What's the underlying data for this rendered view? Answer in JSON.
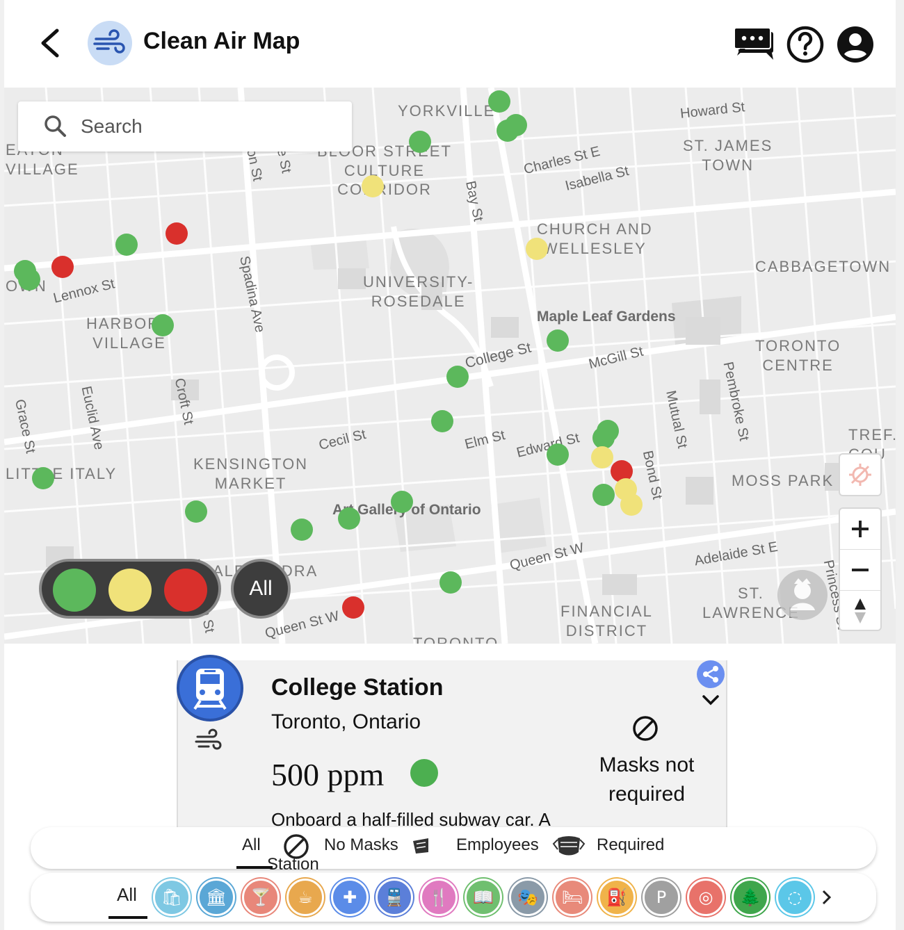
{
  "header": {
    "title": "Clean Air Map"
  },
  "search": {
    "placeholder": "Search"
  },
  "map": {
    "neighbourhoods": [
      {
        "id": "yorkville",
        "label": "YORKVILLE"
      },
      {
        "id": "eaton-village",
        "label": "EATON\nVILLAGE"
      },
      {
        "id": "bloor-st-culture-corridor",
        "label": "BLOOR STREET\nCULTURE\nCORRIDOR"
      },
      {
        "id": "st-james-town",
        "label": "ST. JAMES\nTOWN"
      },
      {
        "id": "church-and-wellesley",
        "label": "CHURCH AND\nWELLESLEY"
      },
      {
        "id": "cabbagetown",
        "label": "CABBAGETOWN"
      },
      {
        "id": "university-rosedale",
        "label": "UNIVERSITY-\nROSEDALE"
      },
      {
        "id": "harbord-village",
        "label": "HARBORD\nVILLAGE"
      },
      {
        "id": "toronto-centre",
        "label": "TORONTO\nCENTRE"
      },
      {
        "id": "kensington-market",
        "label": "KENSINGTON\nMARKET"
      },
      {
        "id": "little-italy",
        "label": "LITTLE ITALY"
      },
      {
        "id": "moss-park",
        "label": "MOSS PARK"
      },
      {
        "id": "alexandra-park",
        "label": "ALEXANDRA\nPARK"
      },
      {
        "id": "financial-district",
        "label": "FINANCIAL\nDISTRICT"
      },
      {
        "id": "st-lawrence",
        "label": "ST.\nLAWRENCE"
      },
      {
        "id": "trefann-court",
        "label": "TREF.\nCOU"
      },
      {
        "id": "toronto-bottom",
        "label": "TORONTO"
      },
      {
        "id": "own",
        "label": "OWN"
      }
    ],
    "streets": [
      {
        "id": "howard-st",
        "label": "Howard St"
      },
      {
        "id": "charles-st-e",
        "label": "Charles St E"
      },
      {
        "id": "isabella-st",
        "label": "Isabella St"
      },
      {
        "id": "bay-st",
        "label": "Bay St"
      },
      {
        "id": "lennox-st",
        "label": "Lennox St"
      },
      {
        "id": "spadina-ave",
        "label": "Spadina Ave"
      },
      {
        "id": "college-st",
        "label": "College St"
      },
      {
        "id": "mcgill-st",
        "label": "McGill St"
      },
      {
        "id": "croft-st",
        "label": "Croft St"
      },
      {
        "id": "euclid-ave",
        "label": "Euclid Ave"
      },
      {
        "id": "grace-st",
        "label": "Grace St"
      },
      {
        "id": "mutual-st",
        "label": "Mutual St"
      },
      {
        "id": "pembroke-st",
        "label": "Pembroke St"
      },
      {
        "id": "cecil-st",
        "label": "Cecil St"
      },
      {
        "id": "elm-st",
        "label": "Elm St"
      },
      {
        "id": "edward-st",
        "label": "Edward St"
      },
      {
        "id": "bond-st",
        "label": "Bond St"
      },
      {
        "id": "queen-st-w",
        "label": "Queen St W"
      },
      {
        "id": "queen-st-w-2",
        "label": "Queen St W"
      },
      {
        "id": "adelaide-st-e",
        "label": "Adelaide St E"
      },
      {
        "id": "princess-st",
        "label": "Princess St"
      },
      {
        "id": "markham-st",
        "label": "Markham St"
      },
      {
        "id": "on-st",
        "label": "on St"
      },
      {
        "id": "e-st",
        "label": "e St"
      }
    ],
    "pois": [
      {
        "id": "maple-leaf-gardens",
        "label": "Maple Leaf Gardens"
      },
      {
        "id": "art-gallery-of-ontario",
        "label": "Art Gallery of Ontario"
      }
    ],
    "markers": [
      {
        "status": "green"
      },
      {
        "status": "green"
      },
      {
        "status": "green"
      },
      {
        "status": "green"
      },
      {
        "status": "yellow"
      },
      {
        "status": "yellow"
      },
      {
        "status": "red"
      },
      {
        "status": "green"
      },
      {
        "status": "red"
      },
      {
        "status": "green"
      },
      {
        "status": "green"
      },
      {
        "status": "green"
      },
      {
        "status": "green"
      },
      {
        "status": "green"
      },
      {
        "status": "green"
      },
      {
        "status": "green"
      },
      {
        "status": "green"
      },
      {
        "status": "green"
      },
      {
        "status": "yellow"
      },
      {
        "status": "red"
      },
      {
        "status": "green"
      },
      {
        "status": "yellow"
      },
      {
        "status": "yellow"
      },
      {
        "status": "green"
      },
      {
        "status": "green"
      },
      {
        "status": "green"
      },
      {
        "status": "green"
      },
      {
        "status": "green"
      },
      {
        "status": "green"
      },
      {
        "status": "red"
      }
    ]
  },
  "legend": {
    "all_label": "All",
    "colors": {
      "green": "#5cb85c",
      "yellow": "#f0e27a",
      "red": "#d9302c"
    }
  },
  "card": {
    "title": "College Station",
    "subtitle": "Toronto, Ontario",
    "ppm": "500 ppm",
    "mask_status": "Masks not required",
    "description": "Onboard a half-filled subway car. A",
    "status_color": "#4caf50"
  },
  "mask_filter": {
    "all": "All",
    "no_masks": "No Masks",
    "employees": "Employees",
    "required": "Required",
    "behind_text": "Station"
  },
  "category_filter": {
    "all": "All",
    "categories": [
      {
        "icon": "shopping-bag-icon",
        "color": "#7ec8e3"
      },
      {
        "icon": "museum-icon",
        "color": "#5aa7d6"
      },
      {
        "icon": "cocktail-icon",
        "color": "#e8877a"
      },
      {
        "icon": "coffee-icon",
        "color": "#e8a84e"
      },
      {
        "icon": "medical-cross-icon",
        "color": "#5b8ce8"
      },
      {
        "icon": "train-icon",
        "color": "#5b7fd9"
      },
      {
        "icon": "restaurant-icon",
        "color": "#e07ac0"
      },
      {
        "icon": "library-icon",
        "color": "#6fbf6f"
      },
      {
        "icon": "theater-icon",
        "color": "#8a9aa8"
      },
      {
        "icon": "hotel-icon",
        "color": "#e88a7a"
      },
      {
        "icon": "gas-pump-icon",
        "color": "#f0b34a"
      },
      {
        "icon": "parking-icon",
        "color": "#a0a0a0"
      },
      {
        "icon": "cinema-icon",
        "color": "#e8726a"
      },
      {
        "icon": "park-icon",
        "color": "#3fa64c"
      },
      {
        "icon": "other-icon",
        "color": "#5bc7e8"
      }
    ]
  }
}
